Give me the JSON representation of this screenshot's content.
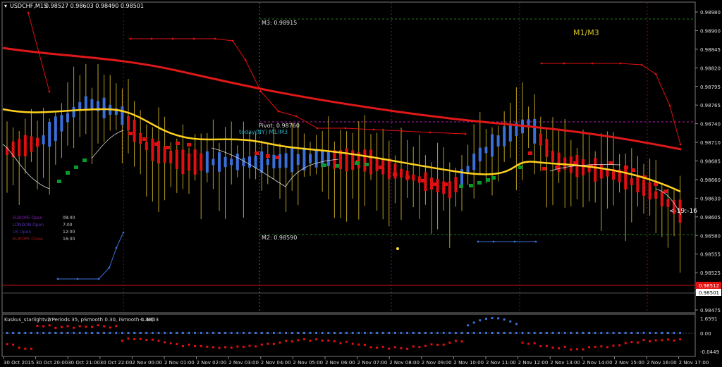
{
  "header": {
    "symbol_tf": "USDCHF,M15",
    "ohlc": "0.98527 0.98603 0.98490 0.98501"
  },
  "labels": {
    "m1m3": "M1/M3",
    "m3": "M3: 0.98915",
    "pivot": "Pivot: 0.98760",
    "today": "today(NY) M1/M3",
    "m2": "M2: 0.98590",
    "timer": "<-19:-16"
  },
  "sessions": [
    {
      "name": "EUROPE Open",
      "time": "08:00",
      "color": "#7a1fa8"
    },
    {
      "name": "LONDON Open",
      "time": "7:00",
      "color": "#5a2fb8"
    },
    {
      "name": "US Open",
      "time": "12:00",
      "color": "#4a2fa0"
    },
    {
      "name": "EUROPE Close",
      "time": "16:00",
      "color": "#a01818"
    }
  ],
  "price_axis": {
    "ticks": [
      "0.98980",
      "0.98900",
      "0.98845",
      "0.98820",
      "0.98795",
      "0.98765",
      "0.98740",
      "0.98710",
      "0.98685",
      "0.98660",
      "0.98630",
      "0.98605",
      "0.98580",
      "0.98555",
      "0.98525",
      "0.98500",
      "0.98475"
    ],
    "current_red": "0.98512",
    "current_bid": "0.98501"
  },
  "indicator": {
    "title": "Kuskus_starlightv2",
    "params": "(rPeriods 35, pSmooth 0.30, iSmooth 0.30)",
    "value": "-1.6803",
    "scale": [
      "1.6591",
      "0.00",
      "-0.0449"
    ]
  },
  "time_axis": [
    "30 Oct 2015",
    "30 Oct 20:00",
    "30 Oct 21:00",
    "30 Oct 22:00",
    "2 Nov 00:00",
    "2 Nov 01:00",
    "2 Nov 02:00",
    "2 Nov 03:00",
    "2 Nov 04:00",
    "2 Nov 05:00",
    "2 Nov 06:00",
    "2 Nov 07:00",
    "2 Nov 08:00",
    "2 Nov 09:00",
    "2 Nov 10:00",
    "2 Nov 11:00",
    "2 Nov 12:00",
    "2 Nov 13:00",
    "2 Nov 14:00",
    "2 Nov 15:00",
    "2 Nov 16:00",
    "2 Nov 17:00"
  ],
  "colors": {
    "background": "#000000",
    "grid": "#333333",
    "bull": "#3b6fd8",
    "bear": "#e01010",
    "wick": "#b8a020",
    "yellow_ma": "#ffd21e",
    "red_ma": "#e01818",
    "green": "#0a9a2a"
  },
  "chart_data": {
    "type": "line",
    "title": "USDCHF,M15",
    "ylim": [
      0.9846,
      0.9899
    ],
    "levels": {
      "M3": 0.98915,
      "Pivot": 0.9876,
      "M2": 0.9859
    }
  }
}
